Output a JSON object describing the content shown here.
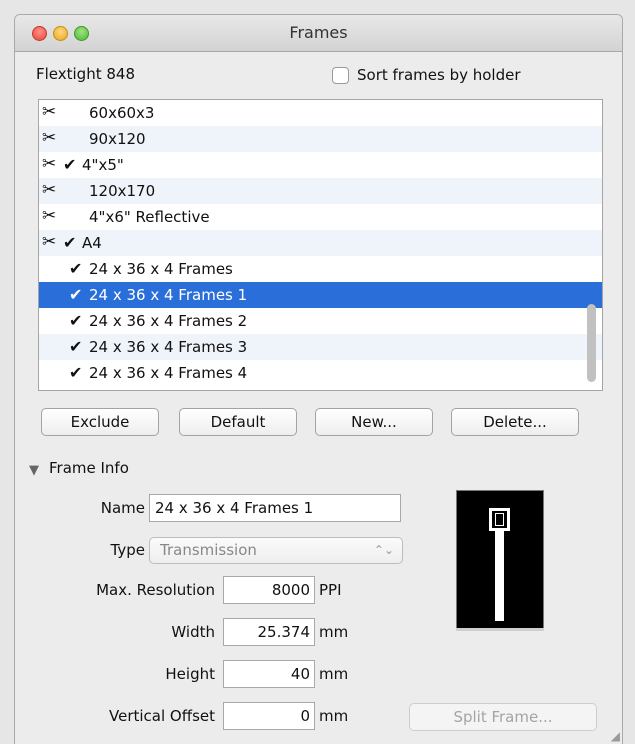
{
  "window": {
    "title": "Frames"
  },
  "header": {
    "scanner": "Flextight 848",
    "sort_label": "Sort frames by holder",
    "sort_checked": false
  },
  "holders": [
    {
      "label": "60x60x3",
      "tool": true,
      "check": false,
      "indent": false,
      "selected": false
    },
    {
      "label": "90x120",
      "tool": true,
      "check": false,
      "indent": false,
      "selected": false
    },
    {
      "label": "4\"x5\"",
      "tool": true,
      "check": true,
      "indent": false,
      "selected": false
    },
    {
      "label": "120x170",
      "tool": true,
      "check": false,
      "indent": false,
      "selected": false
    },
    {
      "label": "4\"x6\" Reflective",
      "tool": true,
      "check": false,
      "indent": false,
      "selected": false
    },
    {
      "label": "A4",
      "tool": true,
      "check": true,
      "indent": false,
      "selected": false
    },
    {
      "label": "24 x 36 x 4 Frames",
      "tool": false,
      "check": true,
      "indent": true,
      "selected": false
    },
    {
      "label": "24 x 36 x 4 Frames 1",
      "tool": false,
      "check": true,
      "indent": true,
      "selected": true
    },
    {
      "label": "24 x 36 x 4 Frames 2",
      "tool": false,
      "check": true,
      "indent": true,
      "selected": false
    },
    {
      "label": "24 x 36 x 4 Frames 3",
      "tool": false,
      "check": true,
      "indent": true,
      "selected": false
    },
    {
      "label": "24 x 36 x 4 Frames 4",
      "tool": false,
      "check": true,
      "indent": true,
      "selected": false
    }
  ],
  "buttons": {
    "exclude": "Exclude",
    "default": "Default",
    "new": "New...",
    "delete": "Delete..."
  },
  "frame_info": {
    "title": "Frame Info",
    "name_label": "Name",
    "name_value": "24 x 36 x 4 Frames 1",
    "type_label": "Type",
    "type_value": "Transmission",
    "maxres_label": "Max. Resolution",
    "maxres_value": "8000",
    "maxres_unit": "PPI",
    "width_label": "Width",
    "width_value": "25.374",
    "width_unit": "mm",
    "height_label": "Height",
    "height_value": "40",
    "height_unit": "mm",
    "voffset_label": "Vertical Offset",
    "voffset_value": "0",
    "voffset_unit": "mm",
    "split_label": "Split Frame..."
  },
  "icons": {
    "tool": "✂",
    "check": "✔",
    "disclosure": "▼",
    "popup_arrows": "⌃⌄",
    "grip": "◢"
  },
  "colors": {
    "selection": "#2a6fd9",
    "alt_row": "#eff4fb"
  }
}
